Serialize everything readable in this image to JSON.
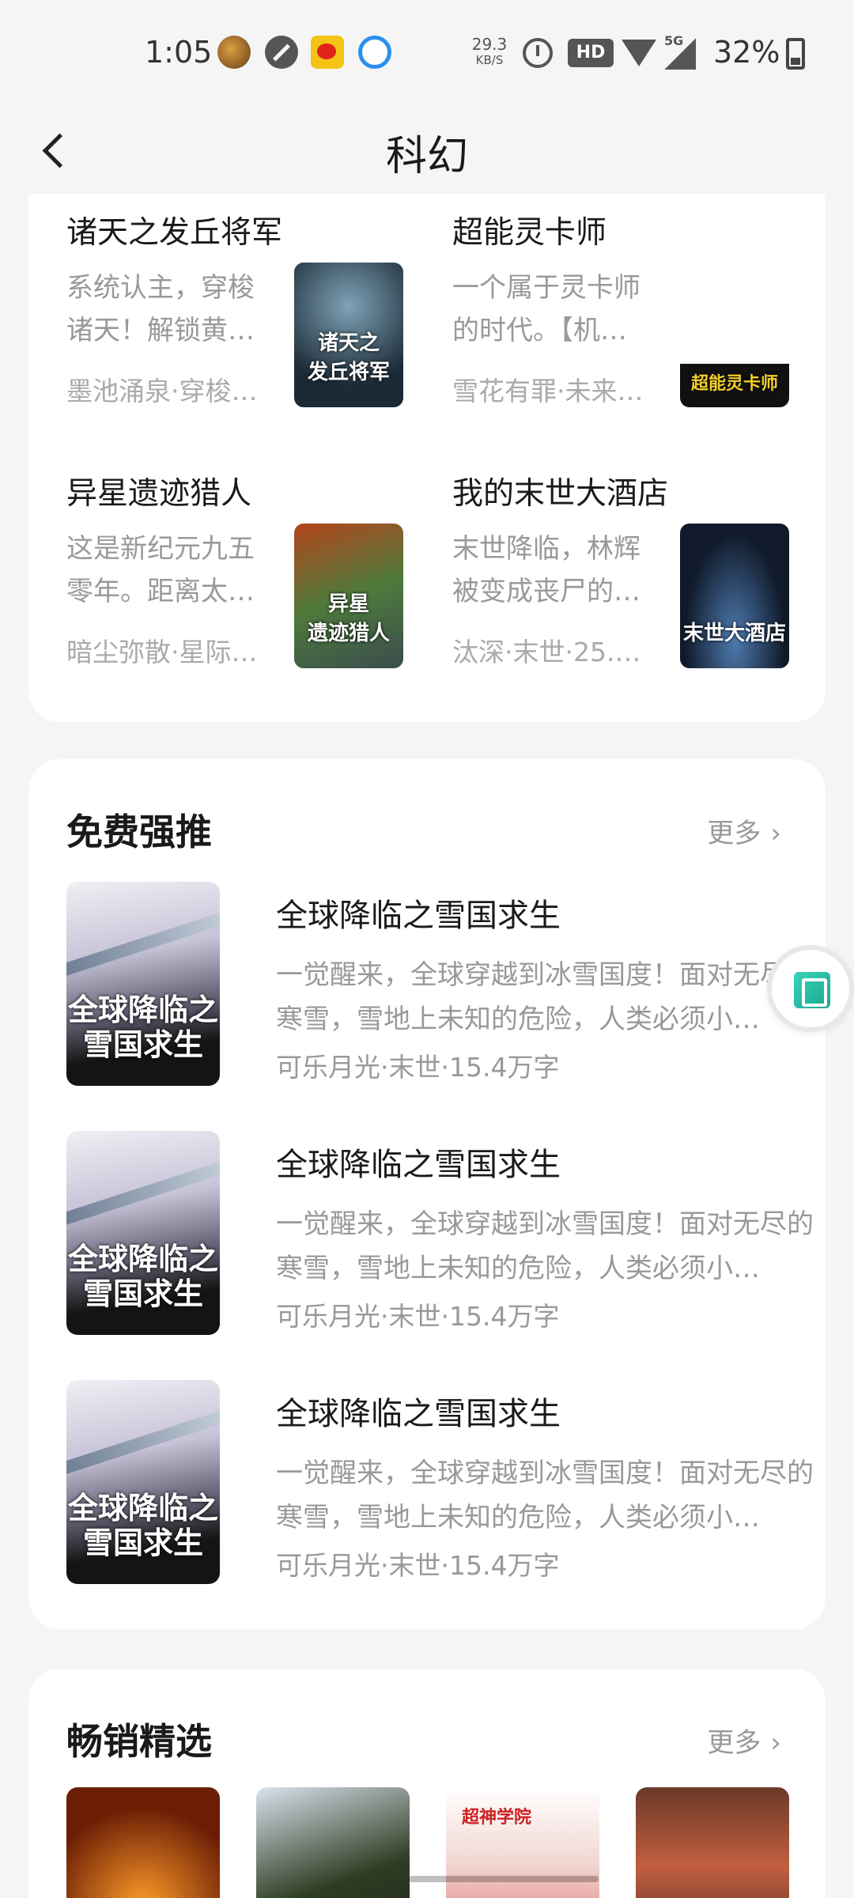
{
  "status_bar": {
    "time": "1:05",
    "net_speed": "29.3",
    "net_unit": "KB/S",
    "hd": "HD",
    "network": "5G",
    "battery": "32%"
  },
  "header": {
    "title": "科幻"
  },
  "grid_books": [
    {
      "title": "诸天之发丘将军",
      "desc": "系统认主，穿梭诸天！解锁黄…",
      "meta": "墨池涌泉·穿梭…",
      "cover_text": "诸天之\n发丘将军"
    },
    {
      "title": "超能灵卡师",
      "desc": "一个属于灵卡师的时代。【机…",
      "meta": "雪花有罪·未来…",
      "cover_text": "超能灵卡师"
    },
    {
      "title": "异星遗迹猎人",
      "desc": "这是新纪元九五零年。距离太…",
      "meta": "暗尘弥散·星际…",
      "cover_text": "异星\n遗迹猎人"
    },
    {
      "title": "我的末世大酒店",
      "desc": "末世降临，林辉被变成丧尸的…",
      "meta": "汰深·末世·25.…",
      "cover_text": "末世大酒店"
    }
  ],
  "free_section": {
    "title": "免费强推",
    "more": "更多",
    "items": [
      {
        "title": "全球降临之雪国求生",
        "desc": "一觉醒来，全球穿越到冰雪国度！面对无尽的寒雪，雪地上未知的危险，人类必须小…",
        "meta": "可乐月光·末世·15.4万字",
        "cover_text": "全球降临之\n雪国求生"
      },
      {
        "title": "全球降临之雪国求生",
        "desc": "一觉醒来，全球穿越到冰雪国度！面对无尽的寒雪，雪地上未知的危险，人类必须小…",
        "meta": "可乐月光·末世·15.4万字",
        "cover_text": "全球降临之\n雪国求生"
      },
      {
        "title": "全球降临之雪国求生",
        "desc": "一觉醒来，全球穿越到冰雪国度！面对无尽的寒雪，雪地上未知的危险，人类必须小…",
        "meta": "可乐月光·末世·15.4万字",
        "cover_text": "全球降临之\n雪国求生"
      }
    ]
  },
  "best_section": {
    "title": "畅销精选",
    "more": "更多"
  },
  "icons": {
    "back": "chevron-left-icon",
    "floating": "cube-app-icon"
  }
}
